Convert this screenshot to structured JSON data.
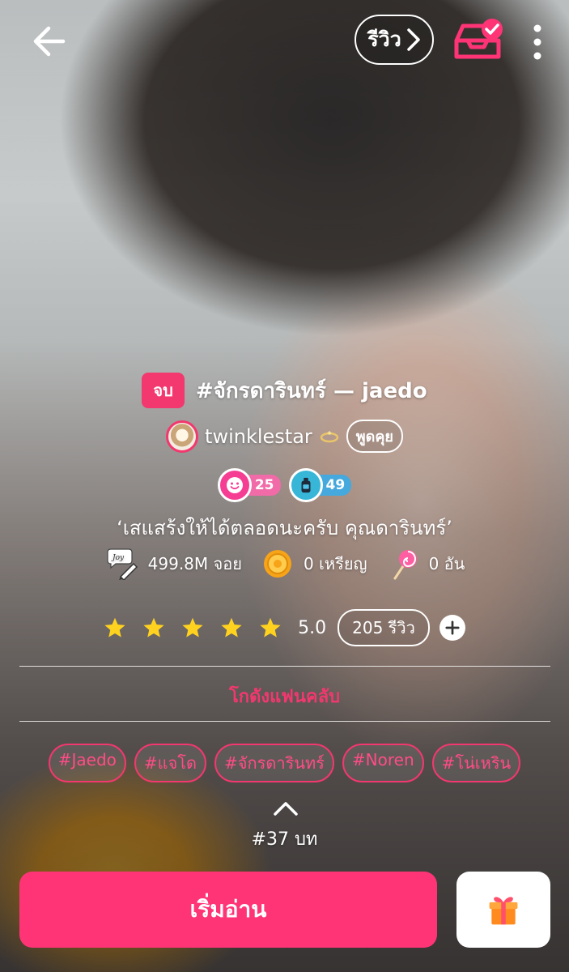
{
  "header": {
    "review_label": "รีวิว",
    "icons": [
      "arrow-left-icon",
      "chevron-right-icon",
      "inbox-check-icon",
      "more-vertical-icon"
    ]
  },
  "story": {
    "status_badge": "จบ",
    "title": "#จักรดารินทร์ — jaedo",
    "author": "twinklestar",
    "chat_label": "พูดคุย",
    "levels": [
      {
        "value": "25",
        "icon": "smiley-icon",
        "color": "#f53d93"
      },
      {
        "value": "49",
        "icon": "bottle-icon",
        "color": "#37b6d8"
      }
    ],
    "tagline": "‘เสแสร้งให้ได้ตลอดนะครับ คุณดารินทร์’"
  },
  "stats": {
    "joy": "499.8M จอย",
    "coins": "0 เหรียญ",
    "candies": "0 อัน"
  },
  "rating": {
    "stars": 5,
    "score": "5.0",
    "reviews": "205 รีวิว",
    "star_color": "#ffd21f"
  },
  "fanclub_label": "โกดังแฟนคลับ",
  "tags": [
    "#Jaedo",
    "#แจโด",
    "#จักรดารินทร์",
    "#Noren",
    "#โน่เหริน"
  ],
  "episodes": "#37 บท",
  "actions": {
    "read_label": "เริ่มอ่าน",
    "gift_icon": "gift-icon"
  },
  "colors": {
    "accent": "#ff3477",
    "accent_dark": "#f2386e"
  }
}
